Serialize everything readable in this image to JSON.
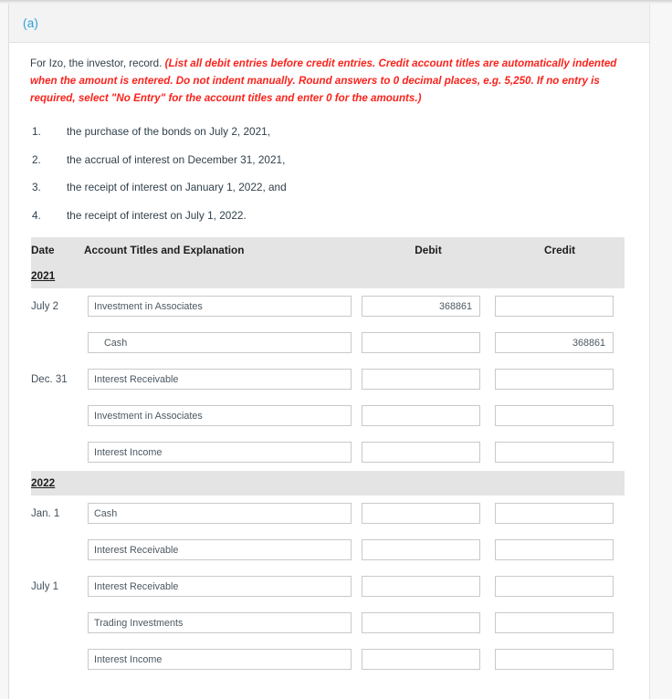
{
  "part": {
    "label": "(a)"
  },
  "instructions": {
    "lead": "For Izo, the investor, record.",
    "note": "(List all debit entries before credit entries. Credit account titles are automatically indented when the amount is entered. Do not indent manually. Round answers to 0 decimal places, e.g. 5,250. If no entry is required, select \"No Entry\" for the account titles and enter 0 for the amounts.)"
  },
  "requirements": [
    {
      "num": "1.",
      "text": "the purchase of the bonds on July 2, 2021,"
    },
    {
      "num": "2.",
      "text": "the accrual of interest on December 31, 2021,"
    },
    {
      "num": "3.",
      "text": "the receipt of interest on January 1, 2022, and"
    },
    {
      "num": "4.",
      "text": "the receipt of interest on July 1, 2022."
    }
  ],
  "journal": {
    "headers": {
      "date": "Date",
      "account": "Account Titles and Explanation",
      "debit": "Debit",
      "credit": "Credit"
    },
    "year_2021": "2021",
    "year_2022": "2022",
    "rows": [
      {
        "date": "July 2",
        "account": "Investment in Associates",
        "indent": false,
        "debit": "368861",
        "credit": ""
      },
      {
        "date": "",
        "account": "Cash",
        "indent": true,
        "debit": "",
        "credit": "368861"
      },
      {
        "date": "Dec. 31",
        "account": "Interest Receivable",
        "indent": false,
        "debit": "",
        "credit": ""
      },
      {
        "date": "",
        "account": "Investment in Associates",
        "indent": false,
        "debit": "",
        "credit": ""
      },
      {
        "date": "",
        "account": "Interest Income",
        "indent": false,
        "debit": "",
        "credit": ""
      },
      {
        "date": "Jan. 1",
        "account": "Cash",
        "indent": false,
        "debit": "",
        "credit": ""
      },
      {
        "date": "",
        "account": "Interest Receivable",
        "indent": false,
        "debit": "",
        "credit": ""
      },
      {
        "date": "July 1",
        "account": "Interest Receivable",
        "indent": false,
        "debit": "",
        "credit": ""
      },
      {
        "date": "",
        "account": "Trading Investments",
        "indent": false,
        "debit": "",
        "credit": ""
      },
      {
        "date": "",
        "account": "Interest Income",
        "indent": false,
        "debit": "",
        "credit": ""
      }
    ],
    "year_break_before_row": 5
  },
  "colors": {
    "accent_blue": "#2ba0dd",
    "instruction_red": "#fb231c",
    "header_gray": "#e4e4e4",
    "panel_gray": "#f3f3f3",
    "field_border": "#c9c9c9"
  }
}
